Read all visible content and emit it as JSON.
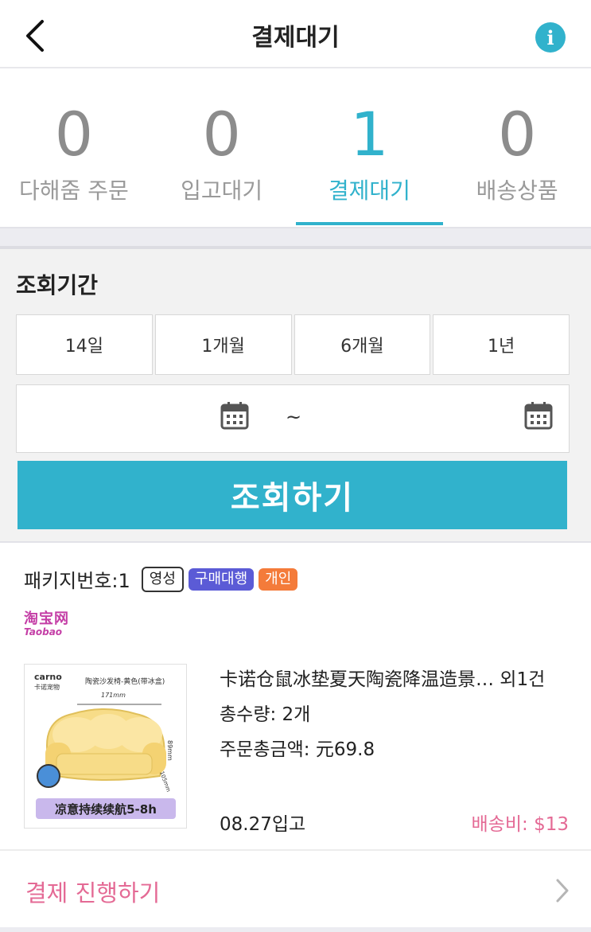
{
  "header": {
    "title": "결제대기",
    "back_icon": "chevron-left-icon",
    "info_icon": "info-icon",
    "info_glyph": "i",
    "accent_color": "#31b2cc"
  },
  "tabs": [
    {
      "count": "0",
      "label": "다해줌 주문",
      "active": false
    },
    {
      "count": "0",
      "label": "입고대기",
      "active": false
    },
    {
      "count": "1",
      "label": "결제대기",
      "active": true
    },
    {
      "count": "0",
      "label": "배송상품",
      "active": false
    }
  ],
  "period": {
    "title": "조회기간",
    "options": [
      "14일",
      "1개월",
      "6개월",
      "1년"
    ],
    "date_separator": "~",
    "start_date": "",
    "end_date": "",
    "search_label": "조회하기"
  },
  "package": {
    "label": "패키지번호:",
    "number": "1",
    "badges": [
      "영성",
      "구매대행",
      "개인"
    ],
    "store_logo_cn": "淘宝网",
    "store_logo_en": "Taobao",
    "image_texts": {
      "brand": "carno",
      "brand_sub": "卡诺宠物",
      "description": "陶瓷沙发椅-黄色(带冰盒)",
      "width": "171mm",
      "height": "89mm",
      "depth": "105mm",
      "banner": "凉意持续续航5-8h"
    },
    "product_name": "卡诺仓鼠冰垫夏天陶瓷降温造景… 외1건",
    "quantity": "총수량: 2개",
    "total": "주문총금액: 元69.8",
    "arrival": "08.27입고",
    "shipping": "배송비: $13",
    "shipping_color": "#e46a95"
  },
  "payment": {
    "label": "결제 진행하기",
    "chevron_icon": "chevron-right-icon"
  }
}
